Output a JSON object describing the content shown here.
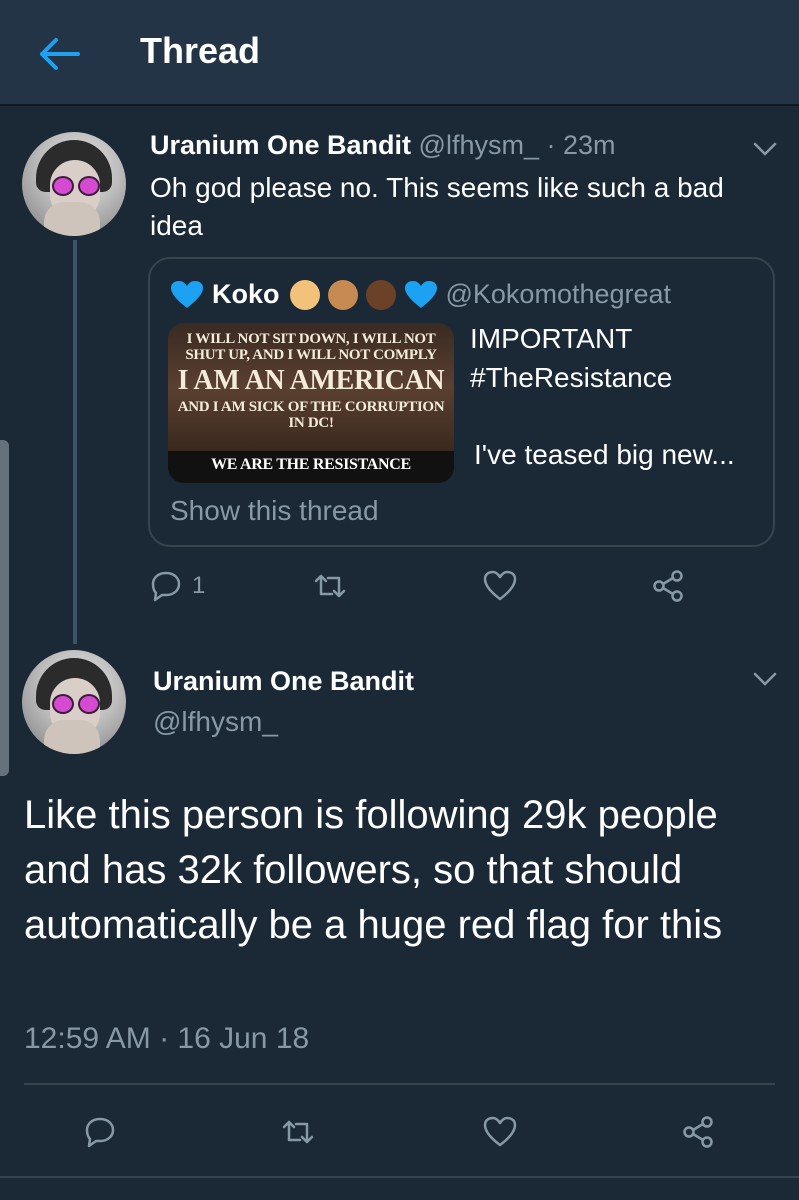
{
  "header": {
    "title": "Thread",
    "back_icon": "arrow-left-icon"
  },
  "colors": {
    "background": "#1b2836",
    "header_bg": "#243447",
    "accent": "#1da1f2",
    "secondary_text": "#8899a6",
    "border": "#38444d"
  },
  "tweet1": {
    "display_name": "Uranium One Bandit",
    "handle": "@lfhysm_",
    "time": "· 23m",
    "text": "Oh god please no. This seems like such a bad idea",
    "quote": {
      "display_name": "Koko",
      "handle": "@Kokomothegreat",
      "text_lines": [
        "IMPORTANT",
        "#TheResistance"
      ],
      "text_continue": "I've teased big new...",
      "image_text": {
        "line1": "I WILL NOT SIT DOWN, I WILL NOT",
        "line2": "SHUT UP, AND I WILL NOT COMPLY",
        "line3": "I AM AN AMERICAN",
        "line4": "AND I AM SICK OF THE CORRUPTION",
        "line5": "IN DC!",
        "line6": "WE ARE THE RESISTANCE"
      },
      "show_thread": "Show this thread"
    },
    "reply_count": "1"
  },
  "tweet2": {
    "display_name": "Uranium One Bandit",
    "handle": "@lfhysm_",
    "text": "Like this person is following 29k people and has 32k followers, so that should automatically be a huge red flag for this",
    "timestamp": "12:59 AM · 16 Jun 18"
  }
}
